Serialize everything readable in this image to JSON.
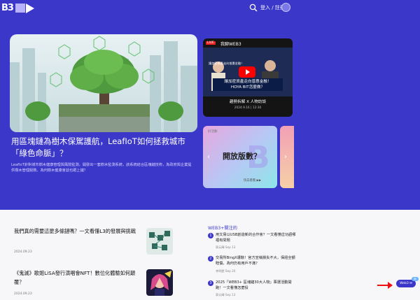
{
  "header": {
    "logo_text": "B3",
    "login_label": "登入 / 註冊"
  },
  "main_article": {
    "title": "用區塊鏈為樹木保駕護航，LeafIoT如何拯救城市「綠色命脈」？",
    "description": "LeafIoT針對城市樹木健康管理與風險監測，開發出一套樹木監測系統，該系統結合區塊鏈技術，為政府與企業提供樹木管理服務。為何樹木健康會話也跟上鏈？"
  },
  "video_card": {
    "live_label": "LIVE",
    "channel": "我聊WEB3",
    "caption": "讓加密資產走向普惠金融！",
    "overlay_line1": "讓加密資產走向普惠金融！",
    "overlay_line2": "HOYA BIT怎麼做？",
    "title": "趨勢拆解 X 人物訪談",
    "date": "2024.9.16 | 12:30"
  },
  "promo_card": {
    "label": "好活動",
    "title": "開放版數？",
    "link": "快去看看 ▶▶"
  },
  "articles": [
    {
      "title": "我們真的需要這麼多條鏈嗎？一文看懂L3的發展與挑戰",
      "date": "2024.09.23"
    },
    {
      "title": "《鬼滅》歌姬LiSA發行演唱會NFT！數位化體驗如何顛覆？",
      "date": "2024.09.23"
    }
  ],
  "sidebar": {
    "title": "WEB3+關注的",
    "items": [
      {
        "num": "1",
        "text": "用文易以USB創造新的合作會？一文看懂這功語哪裡有問題",
        "meta": "郭元輝  Sep 13"
      },
      {
        "num": "2",
        "text": "交易所BingX遭駭！官方宣稱損失不大，保證全額賠償，為何仍有用戶不滿？",
        "meta": "李明歷  Sep 20"
      },
      {
        "num": "3",
        "text": "2025「WEB3+ 區塊鏈30大人物」票選活動開跑！一文看懂怎麼投",
        "meta": "郭元輝  Sep 13"
      }
    ]
  },
  "float_button": {
    "label": "Web3 ✉",
    "badge": "新"
  },
  "colors": {
    "brand": "#3b37c9",
    "accent": "#b9b3ff"
  }
}
